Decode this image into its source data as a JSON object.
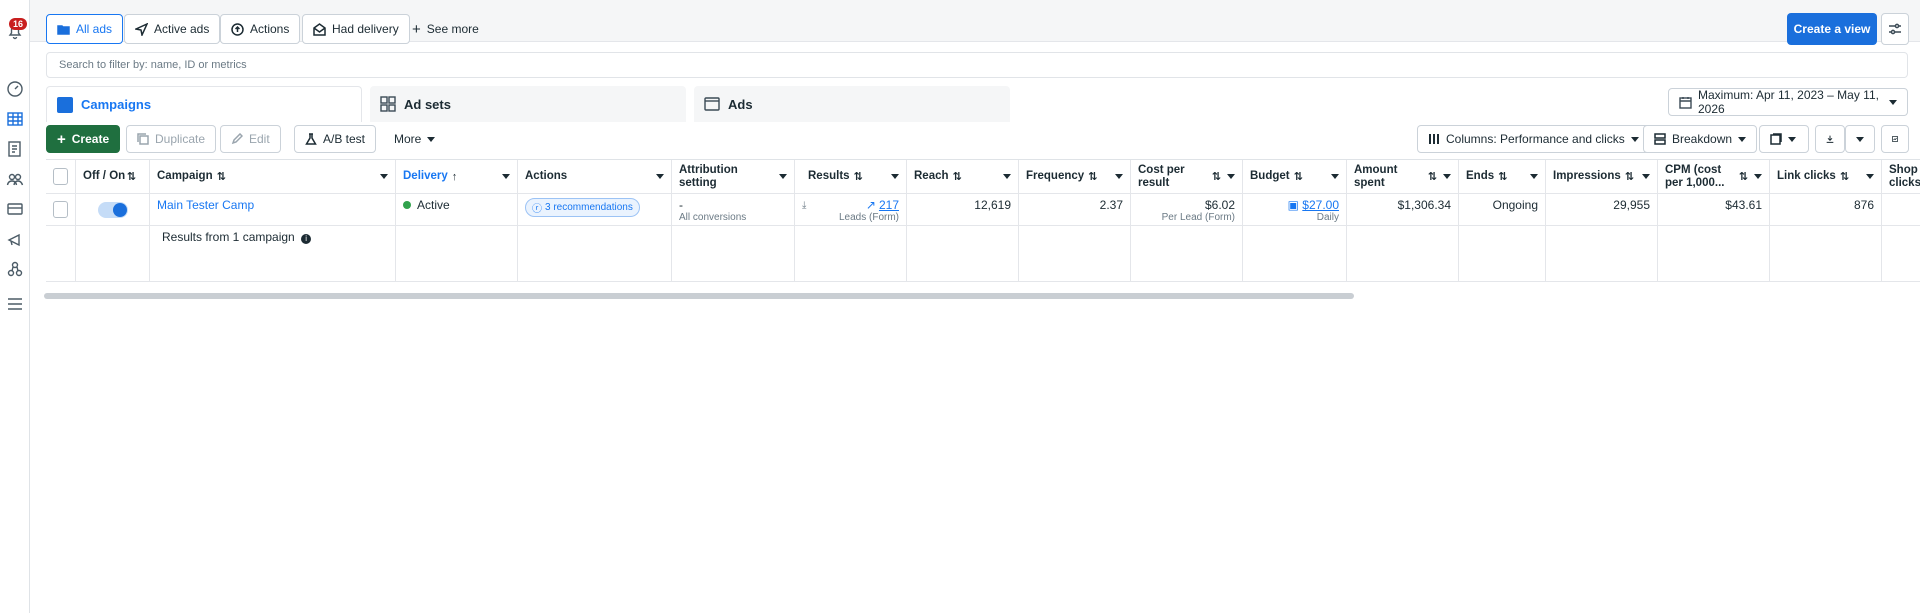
{
  "rail": {
    "notification_count": "16"
  },
  "topbar": {
    "filters": [
      "All ads",
      "Active ads",
      "Actions",
      "Had delivery"
    ],
    "see_more": "See more",
    "create_view": "Create a view"
  },
  "search": {
    "placeholder": "Search to filter by: name, ID or metrics"
  },
  "tabs": {
    "campaigns": "Campaigns",
    "adsets": "Ad sets",
    "ads": "Ads"
  },
  "date_range": "Maximum: Apr 11, 2023 – May 11, 2026",
  "toolbar": {
    "create": "Create",
    "duplicate": "Duplicate",
    "edit": "Edit",
    "ab_test": "A/B test",
    "more": "More",
    "columns": "Columns: Performance and clicks",
    "breakdown": "Breakdown"
  },
  "table": {
    "headers": {
      "offon": "Off / On",
      "campaign": "Campaign",
      "delivery": "Delivery",
      "actions": "Actions",
      "attribution": "Attribution setting",
      "results": "Results",
      "reach": "Reach",
      "frequency": "Frequency",
      "cost": "Cost per result",
      "budget": "Budget",
      "amount": "Amount spent",
      "ends": "Ends",
      "impressions": "Impressions",
      "cpm": "CPM (cost per 1,000...",
      "link_clicks": "Link clicks",
      "shop_clicks": "Shop clicks"
    },
    "row": {
      "campaign": "Main Tester Camp",
      "delivery": "Active",
      "actions": "3 recommendations",
      "attribution": "-",
      "attribution_sub": "All conversions",
      "results": "217",
      "results_sub": "Leads (Form)",
      "reach": "12,619",
      "frequency": "2.37",
      "cost": "$6.02",
      "cost_sub": "Per Lead (Form)",
      "budget": "$27.00",
      "budget_sub": "Daily",
      "amount": "$1,306.34",
      "ends": "Ongoing",
      "impressions": "29,955",
      "cpm": "$43.61",
      "link_clicks": "876"
    },
    "summary": "Results from 1 campaign"
  }
}
